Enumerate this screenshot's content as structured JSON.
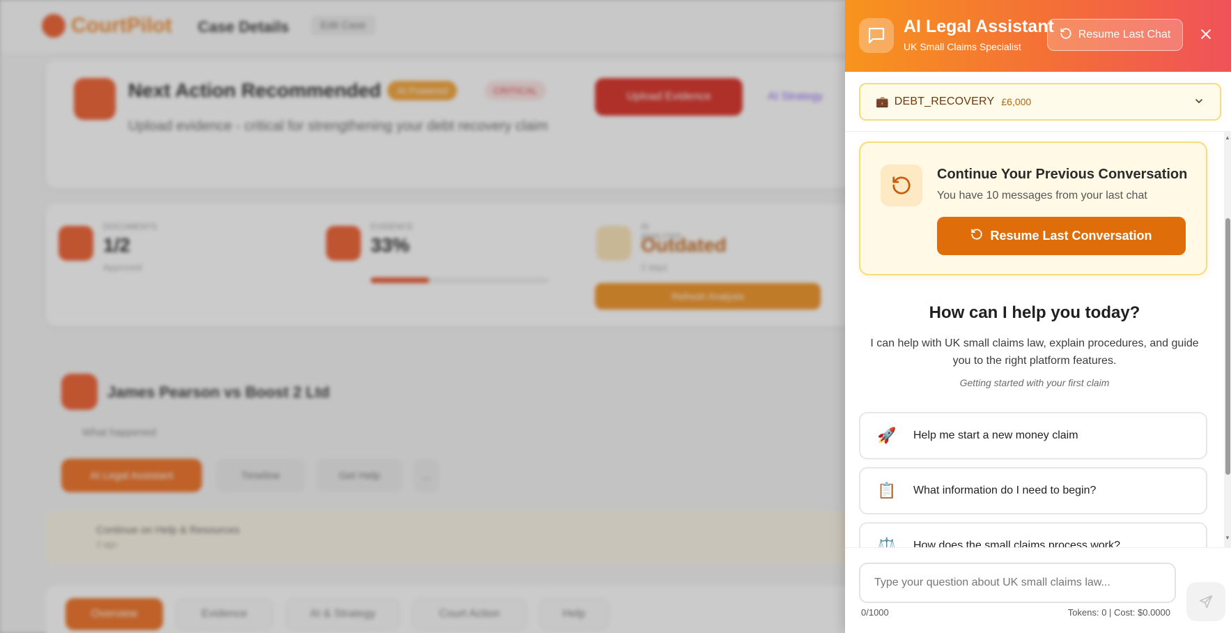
{
  "background": {
    "logo_text": "CourtPilot",
    "page_title": "Case Details",
    "edit_case": "Edit Case",
    "next_action": {
      "title": "Next Action Recommended",
      "badge_primary": "AI Powered",
      "badge_secondary": "CRITICAL",
      "description": "Upload evidence - critical for strengthening your debt recovery claim",
      "button": "Upload Evidence",
      "strategy_link": "AI Strategy"
    },
    "stats": [
      {
        "label": "DOCUMENTS",
        "value": "1/2",
        "sub": "Approved"
      },
      {
        "label": "EVIDENCE",
        "value": "33%",
        "progress": 0.33
      },
      {
        "label": "AI ANALYSIS",
        "value": "Outdated",
        "sub": "2 days"
      }
    ],
    "refresh_button": "Refresh Analysis",
    "case_title": "James Pearson vs Boost 2 Ltd",
    "case_sub": "What happened",
    "case_buttons": [
      "AI Legal Assistant",
      "Timeline",
      "Get Help",
      "..."
    ],
    "help_strip_text": "Continue on Help & Resources",
    "help_strip_sub": "2 ago",
    "tabs": [
      "Overview",
      "Evidence",
      "AI & Strategy",
      "Court Action",
      "Help"
    ]
  },
  "panel": {
    "title": "AI Legal Assistant",
    "subtitle": "UK Small Claims Specialist",
    "resume_last_chat": "Resume Last Chat",
    "context": {
      "type": "DEBT_RECOVERY",
      "amount": "£6,000"
    },
    "continue": {
      "title": "Continue Your Previous Conversation",
      "subtitle": "You have 10 messages from your last chat",
      "button": "Resume Last Conversation"
    },
    "help_title": "How can I help you today?",
    "help_desc": "I can help with UK small claims law, explain procedures, and guide you to the right platform features.",
    "help_hint": "Getting started with your first claim",
    "suggestions": [
      {
        "emoji": "🚀",
        "text": "Help me start a new money claim"
      },
      {
        "emoji": "📋",
        "text": "What information do I need to begin?"
      },
      {
        "emoji": "⚖️",
        "text": "How does the small claims process work?"
      }
    ],
    "input_placeholder": "Type your question about UK small claims law...",
    "char_count": "0/1000",
    "tokens": "Tokens: 0 | Cost: $0.0000"
  },
  "colors": {
    "accent": "#df6d0a",
    "header_start": "#f7941d",
    "header_end": "#f0525a",
    "highlight_bg": "#fff9e6",
    "highlight_border": "#f7dd7a"
  },
  "icons": {
    "chat": "chat-bubble-icon",
    "resume": "rotate-ccw-icon",
    "close": "close-icon",
    "briefcase": "briefcase-icon",
    "dropdown": "chevron-down-icon",
    "send": "send-icon"
  }
}
